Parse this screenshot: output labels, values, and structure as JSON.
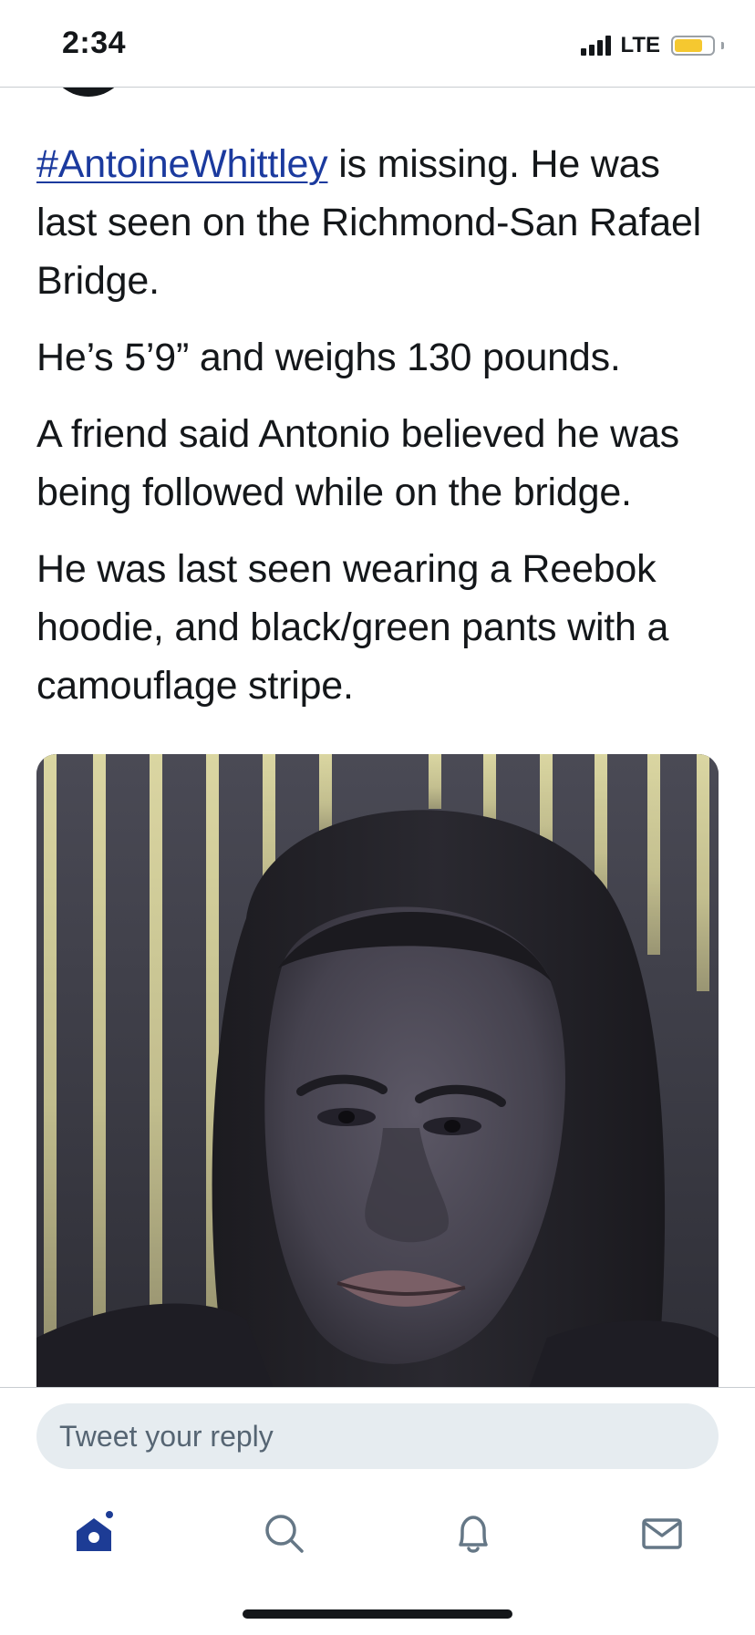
{
  "status_bar": {
    "time": "2:34",
    "network": "LTE",
    "battery_level": 0.75,
    "battery_color": "#f5c830",
    "signal_icon": "cellular-signal-icon"
  },
  "tweet": {
    "hashtag": "#AntoineWhittley",
    "paragraphs": [
      " is missing. He was last seen on the Richmond-San Rafael Bridge.",
      "He’s 5’9” and weighs 130 pounds.",
      "A friend said Antonio believed he was being followed while on the bridge.",
      "He was last seen wearing a Reebok hoodie, and black/green pants with a camouflage stripe."
    ],
    "hashtag_color": "#1b3a9e"
  },
  "reply": {
    "placeholder": "Tweet your reply"
  },
  "tab_bar": {
    "tabs": [
      {
        "icon": "home-icon",
        "active": true
      },
      {
        "icon": "search-icon",
        "active": false
      },
      {
        "icon": "bell-icon",
        "active": false
      },
      {
        "icon": "mail-icon",
        "active": false
      }
    ],
    "accent_color": "#1d3c95"
  }
}
